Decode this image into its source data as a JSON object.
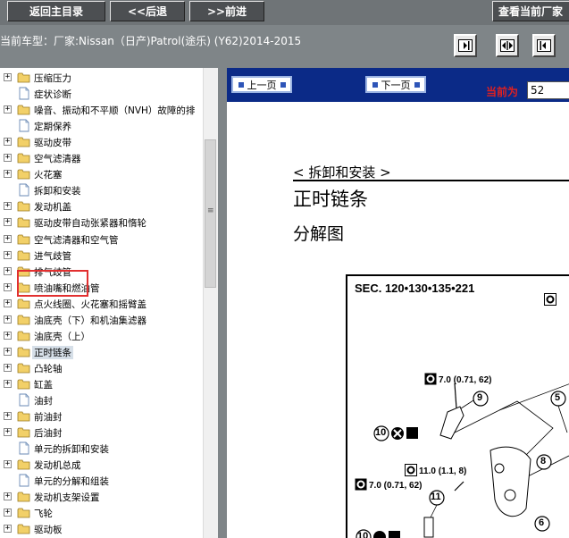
{
  "toolbar": {
    "home_label": "返回主目录",
    "back_label": "<<后退",
    "forward_label": ">>前进",
    "manufacturer_label": "查看当前厂家"
  },
  "vehicle": {
    "text": "当前车型：厂家:Nissan（日产)Patrol(途乐) (Y62)2014-2015"
  },
  "tree": {
    "items": [
      {
        "label": "压缩压力",
        "type": "folder",
        "expandable": true
      },
      {
        "label": "症状诊断",
        "type": "doc",
        "expandable": false
      },
      {
        "label": "噪音、振动和不平顺（NVH）故障的排",
        "type": "folder",
        "expandable": true
      },
      {
        "label": "定期保养",
        "type": "doc",
        "expandable": false
      },
      {
        "label": "驱动皮带",
        "type": "folder",
        "expandable": true
      },
      {
        "label": "空气滤清器",
        "type": "folder",
        "expandable": true
      },
      {
        "label": "火花塞",
        "type": "folder",
        "expandable": true
      },
      {
        "label": "拆卸和安装",
        "type": "doc",
        "expandable": false
      },
      {
        "label": "发动机盖",
        "type": "folder",
        "expandable": true
      },
      {
        "label": "驱动皮带自动张紧器和惰轮",
        "type": "folder",
        "expandable": true
      },
      {
        "label": "空气滤清器和空气管",
        "type": "folder",
        "expandable": true
      },
      {
        "label": "进气歧管",
        "type": "folder",
        "expandable": true
      },
      {
        "label": "排气歧管",
        "type": "folder",
        "expandable": true
      },
      {
        "label": "喷油嘴和燃油管",
        "type": "folder",
        "expandable": true
      },
      {
        "label": "点火线圈、火花塞和摇臂盖",
        "type": "folder",
        "expandable": true
      },
      {
        "label": "油底壳（下）和机油集滤器",
        "type": "folder",
        "expandable": true
      },
      {
        "label": "油底壳（上）",
        "type": "folder",
        "expandable": true
      },
      {
        "label": "正时链条",
        "type": "folder",
        "expandable": true,
        "selected": true
      },
      {
        "label": "凸轮轴",
        "type": "folder",
        "expandable": true
      },
      {
        "label": "缸盖",
        "type": "folder",
        "expandable": true
      },
      {
        "label": "油封",
        "type": "doc",
        "expandable": false
      },
      {
        "label": "前油封",
        "type": "folder",
        "expandable": true
      },
      {
        "label": "后油封",
        "type": "folder",
        "expandable": true
      },
      {
        "label": "单元的拆卸和安装",
        "type": "doc",
        "expandable": false
      },
      {
        "label": "发动机总成",
        "type": "folder",
        "expandable": true
      },
      {
        "label": "单元的分解和组装",
        "type": "doc",
        "expandable": false
      },
      {
        "label": "发动机支架设置",
        "type": "folder",
        "expandable": true
      },
      {
        "label": "飞轮",
        "type": "folder",
        "expandable": true
      },
      {
        "label": "驱动板",
        "type": "folder",
        "expandable": true
      }
    ]
  },
  "doc": {
    "prev_label": "上一页",
    "next_label": "下一页",
    "current_label": "当前为",
    "page_value": "52",
    "section_heading": "< 拆卸和安装 >",
    "title": "正时链条",
    "subtitle": "分解图",
    "diagram": {
      "sec_label": "SEC. 120•130•135•221",
      "torque_a": "7.0 (0.71, 62)",
      "torque_b": "11.0 (1.1, 8)",
      "torque_c": "7.0 (0.71, 62)",
      "callouts": [
        "9",
        "10",
        "5",
        "8",
        "11",
        "6",
        "10"
      ]
    }
  },
  "colors": {
    "nav_bar": "#0b2a87",
    "selection_box": "#e23030",
    "folder": "#f2d068"
  }
}
